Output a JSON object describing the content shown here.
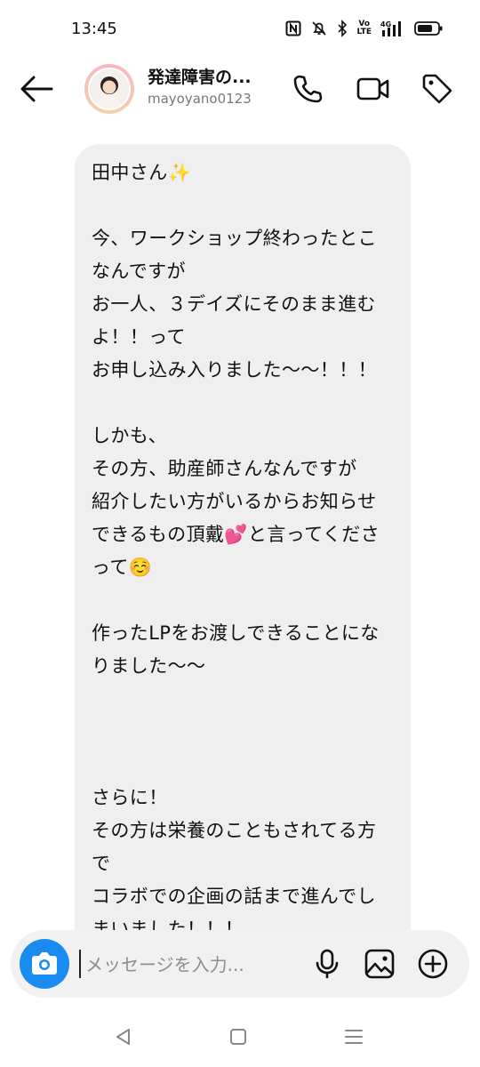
{
  "status_bar": {
    "time": "13:45",
    "icons": [
      "nfc-icon",
      "silent-bell-icon",
      "bluetooth-icon",
      "volte-icon",
      "4g-signal-icon",
      "battery-icon"
    ],
    "volte_text": "Vo\nLTE",
    "network_text": "4G"
  },
  "header": {
    "title": "発達障害の...",
    "handle": "mayoyano0123",
    "actions": [
      "phone-icon",
      "video-call-icon",
      "tag-icon"
    ]
  },
  "message": {
    "paragraphs": [
      "田中さん✨",
      "今、ワークショップ終わったとこなんですが",
      "お一人、３デイズにそのまま進むよ！！って",
      "お申し込み入りました〜〜！！！",
      "しかも、",
      "その方、助産師さんなんですが",
      "紹介したい方がいるからお知らせできるもの頂戴💕と言ってくださって☺️",
      "作ったLPをお渡しできることになりました〜〜",
      "さらに！",
      "その方は栄養のこともされてる方で",
      "コラボでの企画の話まで進んでしまいました！！！"
    ]
  },
  "composer": {
    "placeholder": "メッセージを入力...",
    "icons": [
      "camera-icon",
      "microphone-icon",
      "image-icon",
      "add-icon"
    ]
  },
  "colors": {
    "accent": "#1a8cf0",
    "bubble": "#efefef",
    "composer": "#f1f1f1"
  },
  "nav": [
    "back-triangle-icon",
    "home-square-icon",
    "menu-lines-icon"
  ]
}
